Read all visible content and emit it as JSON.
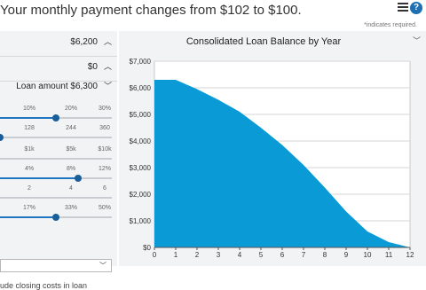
{
  "header": {
    "headline": "Your monthly payment changes from $102 to $100.",
    "required_note": "*indicates required."
  },
  "left": {
    "rows": [
      {
        "value": "$6,200"
      },
      {
        "value": "$0"
      },
      {
        "value": "Loan amount $6,300"
      }
    ],
    "sliders": [
      {
        "ticks": [
          "10%",
          "20%",
          "30%"
        ],
        "level": 0.5
      },
      {
        "ticks": [
          "128",
          "244",
          "360"
        ],
        "level": 0.0
      },
      {
        "ticks": [
          "$1k",
          "$5k",
          "$10k"
        ],
        "level": null
      },
      {
        "ticks": [
          "4%",
          "8%",
          "12%"
        ],
        "level": 0.7
      },
      {
        "ticks": [
          "2",
          "4",
          "6"
        ],
        "level": null
      },
      {
        "ticks": [
          "17%",
          "33%",
          "50%"
        ],
        "level": 0.5
      }
    ],
    "closing_costs_label": "ude closing costs in loan"
  },
  "icons": {
    "menu": "menu-icon",
    "help": "help-icon",
    "chevron": "chevron-down-icon"
  },
  "colors": {
    "accent": "#1f75c0",
    "area": "#0a9ad6",
    "panel": "#f2f3f5"
  },
  "chart_data": {
    "type": "area",
    "title": "Consolidated Loan Balance by Year",
    "x": [
      0,
      1,
      2,
      3,
      4,
      5,
      6,
      7,
      8,
      9,
      10,
      11,
      12
    ],
    "xtick_labels": [
      "0",
      "1",
      "2",
      "3",
      "4",
      "5",
      "6",
      "7",
      "8",
      "9",
      "10",
      "11",
      "12"
    ],
    "values": [
      6300,
      6300,
      5950,
      5550,
      5100,
      4500,
      3850,
      3100,
      2250,
      1350,
      600,
      200,
      0
    ],
    "ytick_labels": [
      "$0",
      "$1,000",
      "$2,000",
      "$3,000",
      "$4,000",
      "$5,000",
      "$6,000",
      "$7,000"
    ],
    "ylim": [
      0,
      7000
    ],
    "xlim": [
      0,
      12
    ],
    "grid": true
  }
}
